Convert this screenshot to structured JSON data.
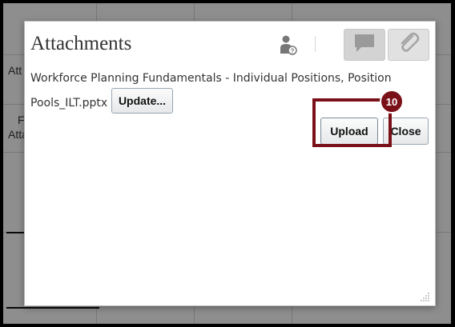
{
  "background": {
    "fragments": [
      "Att",
      "F",
      "Atta"
    ]
  },
  "dialog": {
    "title": "Attachments",
    "file_name_line1": "Workforce Planning Fundamentals - Individual Positions, Position",
    "file_name_line2": "Pools_ILT.pptx",
    "update_label": "Update...",
    "upload_label": "Upload",
    "close_label": "Close"
  },
  "annotation": {
    "step_number": "10",
    "highlight_color": "#7b1118"
  },
  "icons": {
    "help": "help-icon",
    "comment": "comment-icon",
    "attach": "paperclip-icon",
    "resize": "resize-grip-icon"
  }
}
